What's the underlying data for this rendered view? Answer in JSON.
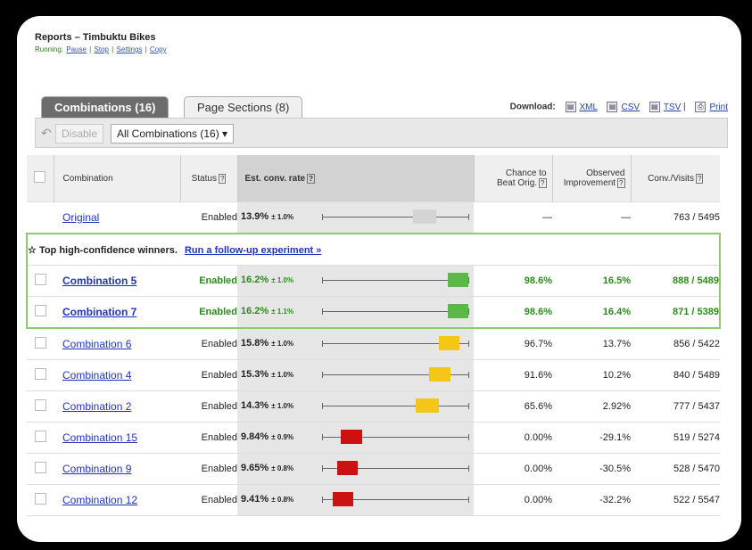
{
  "header": {
    "title": "Reports – Timbuktu Bikes",
    "status": "Running:",
    "links": [
      "Pause",
      "Stop",
      "Settings",
      "Copy"
    ]
  },
  "tabs": [
    {
      "label": "Combinations (16)",
      "active": true
    },
    {
      "label": "Page Sections (8)",
      "active": false
    }
  ],
  "downloads": {
    "label": "Download:",
    "items": [
      "XML",
      "CSV",
      "TSV",
      "Print"
    ]
  },
  "toolbar": {
    "disable_label": "Disable",
    "filter_value": "All Combinations (16) ▾"
  },
  "table": {
    "headers": {
      "combination": "Combination",
      "status": "Status",
      "est": "Est. conv. rate",
      "chance_l1": "Chance to",
      "chance_l2": "Beat Orig.",
      "improvement_l1": "Observed",
      "improvement_l2": "Improvement",
      "conv": "Conv./Visits",
      "help": "?"
    },
    "banner": {
      "text": "Top high-confidence winners.",
      "link": "Run a follow-up experiment »"
    },
    "rows": [
      {
        "name": "Original",
        "status": "Enabled",
        "rate": "13.9%",
        "pm": "± 1.0%",
        "chance": "—",
        "improvement": "—",
        "conv": "763 / 5495",
        "bar_start": 0.62,
        "bar_end": 0.78,
        "color": "#d4d4d4",
        "original": true
      },
      {
        "name": "Combination 5",
        "status": "Enabled",
        "rate": "16.2%",
        "pm": "± 1.0%",
        "chance": "98.6%",
        "improvement": "16.5%",
        "conv": "888 / 5489",
        "bar_start": 0.86,
        "bar_end": 1.0,
        "color": "#5cb848",
        "winner": true
      },
      {
        "name": "Combination 7",
        "status": "Enabled",
        "rate": "16.2%",
        "pm": "± 1.1%",
        "chance": "98.6%",
        "improvement": "16.4%",
        "conv": "871 / 5389",
        "bar_start": 0.86,
        "bar_end": 1.0,
        "color": "#5cb848",
        "winner": true
      },
      {
        "name": "Combination 6",
        "status": "Enabled",
        "rate": "15.8%",
        "pm": "± 1.0%",
        "chance": "96.7%",
        "improvement": "13.7%",
        "conv": "856 / 5422",
        "bar_start": 0.8,
        "bar_end": 0.94,
        "color": "#f5c518"
      },
      {
        "name": "Combination 4",
        "status": "Enabled",
        "rate": "15.3%",
        "pm": "± 1.0%",
        "chance": "91.6%",
        "improvement": "10.2%",
        "conv": "840 / 5489",
        "bar_start": 0.73,
        "bar_end": 0.88,
        "color": "#f5c518"
      },
      {
        "name": "Combination 2",
        "status": "Enabled",
        "rate": "14.3%",
        "pm": "± 1.0%",
        "chance": "65.6%",
        "improvement": "2.92%",
        "conv": "777 / 5437",
        "bar_start": 0.64,
        "bar_end": 0.8,
        "color": "#f5c518"
      },
      {
        "name": "Combination 15",
        "status": "Enabled",
        "rate": "9.84%",
        "pm": "± 0.9%",
        "chance": "0.00%",
        "improvement": "-29.1%",
        "conv": "519 / 5274",
        "bar_start": 0.12,
        "bar_end": 0.27,
        "color": "#cc1111"
      },
      {
        "name": "Combination 9",
        "status": "Enabled",
        "rate": "9.65%",
        "pm": "± 0.8%",
        "chance": "0.00%",
        "improvement": "-30.5%",
        "conv": "528 / 5470",
        "bar_start": 0.1,
        "bar_end": 0.24,
        "color": "#cc1111"
      },
      {
        "name": "Combination 12",
        "status": "Enabled",
        "rate": "9.41%",
        "pm": "± 0.8%",
        "chance": "0.00%",
        "improvement": "-32.2%",
        "conv": "522 / 5547",
        "bar_start": 0.07,
        "bar_end": 0.21,
        "color": "#cc1111"
      }
    ]
  }
}
